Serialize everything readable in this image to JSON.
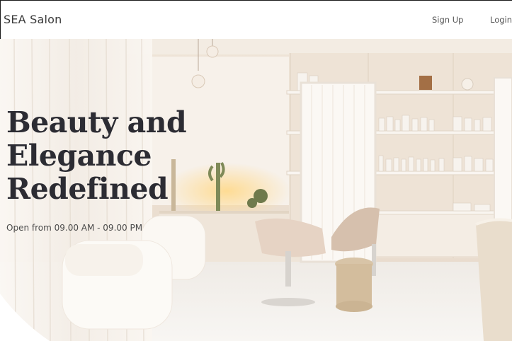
{
  "navbar": {
    "brand": "SEA Salon",
    "links": [
      {
        "label": "Sign Up"
      },
      {
        "label": "Login"
      }
    ]
  },
  "hero": {
    "title": "Beauty and\nElegance\nRedefined",
    "hours": "Open from 09.00 AM - 09.00 PM",
    "image_description_icon": "salon-interior-photo"
  },
  "colors": {
    "title": "#2c2c33",
    "background": "#ffffff",
    "wall": "#efe6dc",
    "floor": "#f4f1ee"
  }
}
